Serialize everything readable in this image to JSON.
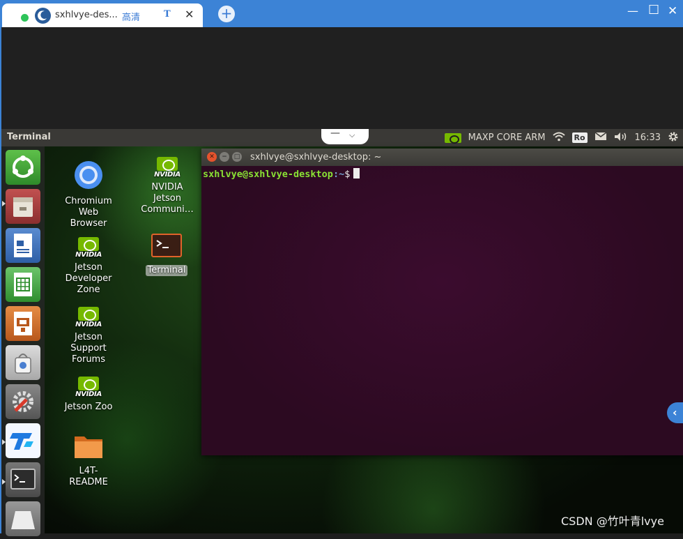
{
  "browser": {
    "tab_title": "sxhlvye-des...",
    "tab_quality": "高清",
    "tab_t": "T",
    "tab_close": "✕",
    "new_tab": "+",
    "minimize": "—",
    "maximize": "☐",
    "close": "✕"
  },
  "panel": {
    "title": "Terminal",
    "notch_minus": "—",
    "notch_chevron": "⌵",
    "power_mode": "MAXP CORE ARM",
    "keyboard": "Ro",
    "time": "16:33"
  },
  "desktop_icons": {
    "chromium": "Chromium Web Browser",
    "nvidia_community": "NVIDIA Jetson Communi…",
    "developer_zone": "Jetson Developer Zone",
    "terminal": "Terminal",
    "support_forums": "Jetson Support Forums",
    "jetson_zoo": "Jetson Zoo",
    "readme": "L4T-README",
    "nvidia_wordmark": "NVIDIA"
  },
  "terminal": {
    "title": "sxhlvye@sxhlvye-desktop: ~",
    "prompt_user": "sxhlvye@sxhlvye-desktop",
    "prompt_path": ":~",
    "prompt_symbol": "$"
  },
  "side_handle": "‹",
  "watermark": "CSDN @竹叶青lvye",
  "colors": {
    "browser_blue": "#3c83d6",
    "terminal_bg": "#2c0a21",
    "prompt_green": "#8ae234",
    "nvidia_green": "#76b900"
  }
}
